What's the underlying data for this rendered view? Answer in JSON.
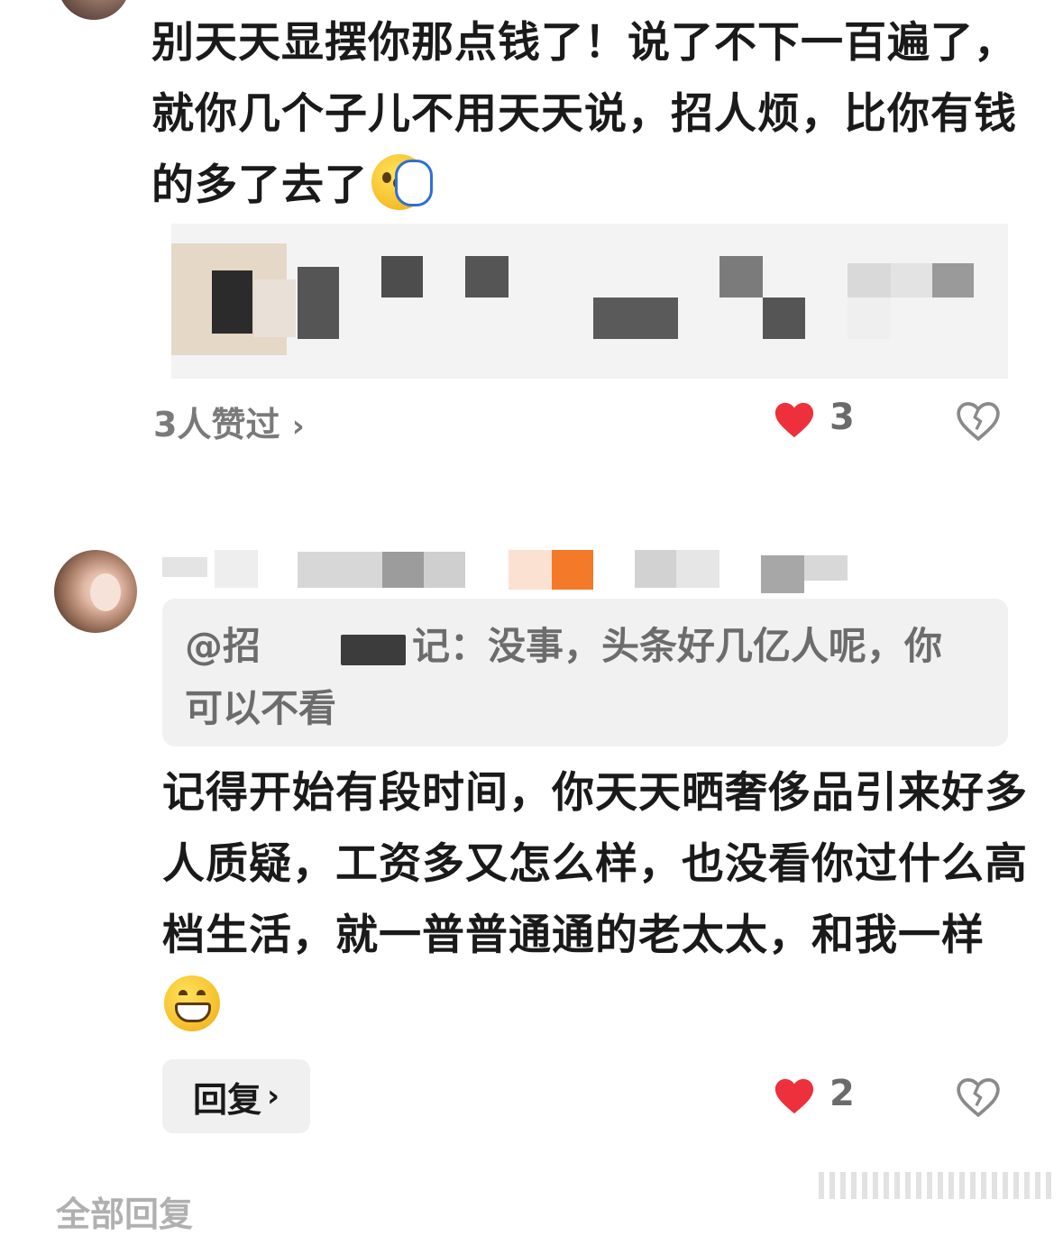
{
  "comment1": {
    "text": "别天天显摆你那点钱了！说了不下一百遍了，就你几个子儿不用天天说，招人烦，比你有钱的多了去了",
    "emoji": "face-palm-emoji",
    "likers_label": "3人赞过",
    "like_count": "3"
  },
  "comment2": {
    "quote_text": "@招   　记：没事，头条好几亿人呢，你可以不看",
    "text": "记得开始有段时间，你天天晒奢侈品引来好多人质疑，工资多又怎么样，也没看你过什么高档生活，就一普普通通的老太太，和我一样",
    "emoji": "grinning-face-emoji",
    "reply_label": "回复",
    "like_count": "2"
  },
  "footer": {
    "all_replies_label": "全部回复"
  },
  "colors": {
    "heart_red": "#ee2f3c",
    "quote_bg": "#f1f1f1",
    "muted_text": "#7a7a7a"
  }
}
